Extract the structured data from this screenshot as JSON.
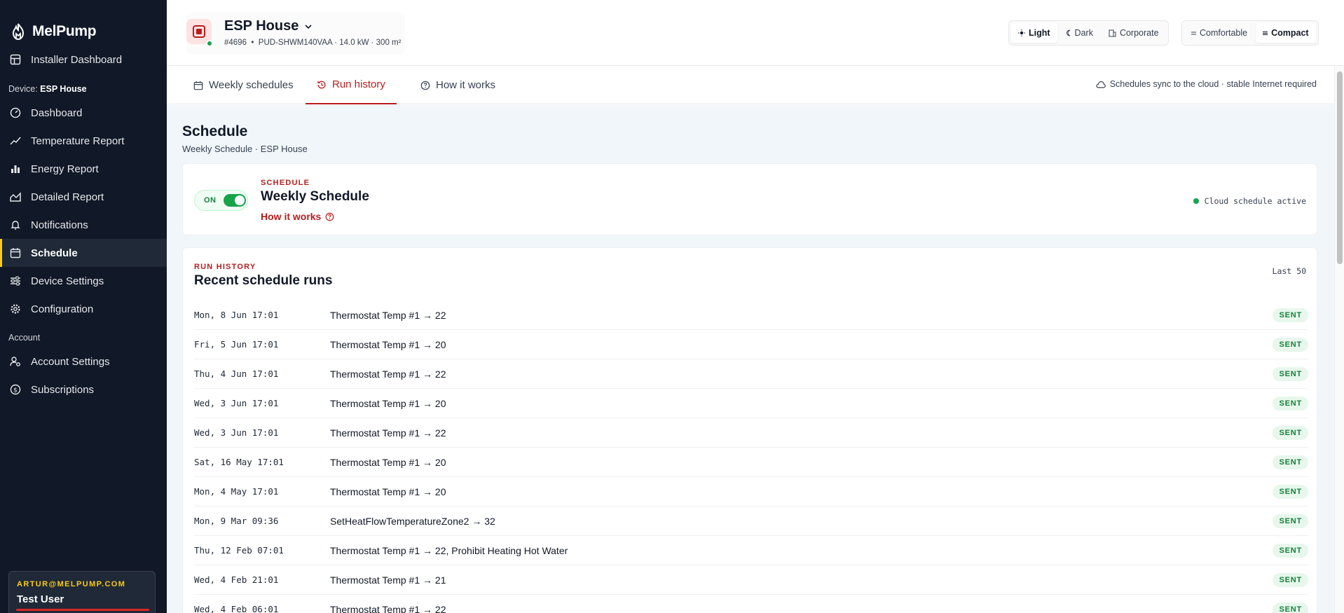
{
  "app": {
    "name": "MelPump"
  },
  "sidebar": {
    "installer_dashboard": "Installer Dashboard",
    "device_prefix": "Device:",
    "device_name": "ESP House",
    "items": [
      {
        "label": "Dashboard",
        "icon": "gauge-icon"
      },
      {
        "label": "Temperature Report",
        "icon": "trend-line-icon"
      },
      {
        "label": "Energy Report",
        "icon": "bar-chart-icon"
      },
      {
        "label": "Detailed Report",
        "icon": "area-chart-icon"
      },
      {
        "label": "Notifications",
        "icon": "bell-icon"
      },
      {
        "label": "Schedule",
        "icon": "calendar-icon",
        "active": true
      },
      {
        "label": "Device Settings",
        "icon": "sliders-icon"
      },
      {
        "label": "Configuration",
        "icon": "gear-icon"
      }
    ],
    "account_heading": "Account",
    "account_items": [
      {
        "label": "Account Settings",
        "icon": "user-cog-icon"
      },
      {
        "label": "Subscriptions",
        "icon": "dollar-circle-icon"
      }
    ],
    "user": {
      "email": "ARTUR@MELPUMP.COM",
      "name": "Test User"
    }
  },
  "header": {
    "device_name": "ESP House",
    "device_id": "#4696",
    "device_specs": "PUD-SHWM140VAA · 14.0 kW · 300 m²",
    "themes": [
      "Light",
      "Dark",
      "Corporate"
    ],
    "active_theme": "Light",
    "densities": [
      "Comfortable",
      "Compact"
    ],
    "active_density": "Compact"
  },
  "tabs": [
    {
      "label": "Weekly schedules",
      "icon": "calendar-icon"
    },
    {
      "label": "Run history",
      "icon": "history-icon",
      "active": true
    },
    {
      "label": "How it works",
      "icon": "help-circle-icon"
    }
  ],
  "sync_note": "Schedules sync to the cloud · stable Internet required",
  "page": {
    "title": "Schedule",
    "subtitle": "Weekly Schedule · ESP House"
  },
  "schedule_card": {
    "toggle_label": "ON",
    "kicker": "SCHEDULE",
    "title": "Weekly Schedule",
    "how_link": "How it works",
    "status": "Cloud schedule active"
  },
  "history_card": {
    "kicker": "RUN HISTORY",
    "title": "Recent schedule runs",
    "count_label": "Last 50",
    "rows": [
      {
        "date": "Mon, 8 Jun 17:01",
        "action": "Thermostat Temp #1 → 22",
        "status": "SENT"
      },
      {
        "date": "Fri, 5 Jun 17:01",
        "action": "Thermostat Temp #1 → 20",
        "status": "SENT"
      },
      {
        "date": "Thu, 4 Jun 17:01",
        "action": "Thermostat Temp #1 → 22",
        "status": "SENT"
      },
      {
        "date": "Wed, 3 Jun 17:01",
        "action": "Thermostat Temp #1 → 20",
        "status": "SENT"
      },
      {
        "date": "Wed, 3 Jun 17:01",
        "action": "Thermostat Temp #1 → 22",
        "status": "SENT"
      },
      {
        "date": "Sat, 16 May 17:01",
        "action": "Thermostat Temp #1 → 20",
        "status": "SENT"
      },
      {
        "date": "Mon, 4 May 17:01",
        "action": "Thermostat Temp #1 → 20",
        "status": "SENT"
      },
      {
        "date": "Mon, 9 Mar 09:36",
        "action": "SetHeatFlowTemperatureZone2 → 32",
        "status": "SENT"
      },
      {
        "date": "Thu, 12 Feb 07:01",
        "action": "Thermostat Temp #1 → 22, Prohibit Heating Hot Water",
        "status": "SENT"
      },
      {
        "date": "Wed, 4 Feb 21:01",
        "action": "Thermostat Temp #1 → 21",
        "status": "SENT"
      },
      {
        "date": "Wed, 4 Feb 06:01",
        "action": "Thermostat Temp #1 → 22",
        "status": "SENT"
      }
    ]
  }
}
